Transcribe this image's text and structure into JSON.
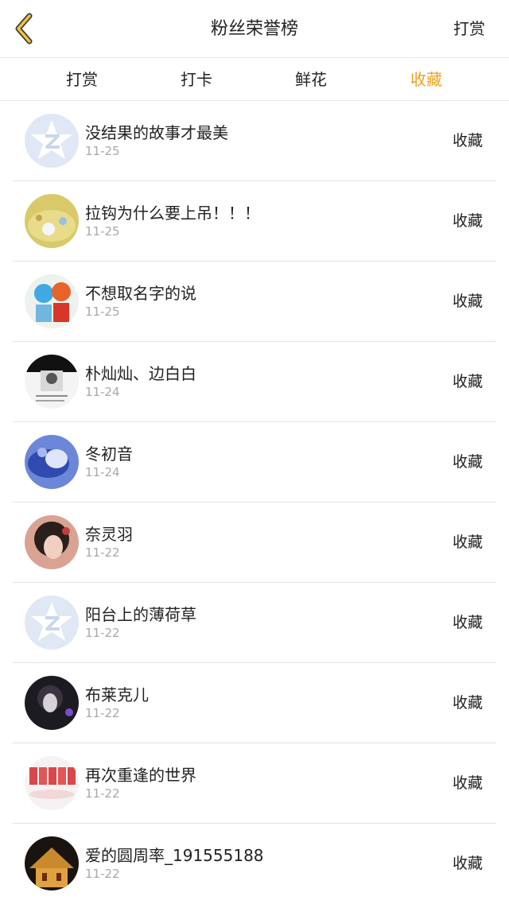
{
  "header": {
    "title": "粉丝荣誉榜",
    "action_label": "打赏",
    "back_icon": "chevron-left-icon",
    "accent_color": "#f0a020"
  },
  "tabs": [
    {
      "label": "打赏",
      "active": false
    },
    {
      "label": "打卡",
      "active": false
    },
    {
      "label": "鲜花",
      "active": false
    },
    {
      "label": "收藏",
      "active": true
    }
  ],
  "list": [
    {
      "name": "没结果的故事才最美",
      "date": "11-25",
      "action": "收藏"
    },
    {
      "name": "拉钩为什么要上吊！！！",
      "date": "11-25",
      "action": "收藏"
    },
    {
      "name": "不想取名字的说",
      "date": "11-25",
      "action": "收藏"
    },
    {
      "name": "朴灿灿、边白白",
      "date": "11-24",
      "action": "收藏"
    },
    {
      "name": "冬初音",
      "date": "11-24",
      "action": "收藏"
    },
    {
      "name": "奈灵羽",
      "date": "11-22",
      "action": "收藏"
    },
    {
      "name": "阳台上的薄荷草",
      "date": "11-22",
      "action": "收藏"
    },
    {
      "name": "布莱克儿",
      "date": "11-22",
      "action": "收藏"
    },
    {
      "name": "再次重逢的世界",
      "date": "11-22",
      "action": "收藏"
    },
    {
      "name": "爱的圆周率_191555188",
      "date": "11-22",
      "action": "收藏"
    }
  ]
}
